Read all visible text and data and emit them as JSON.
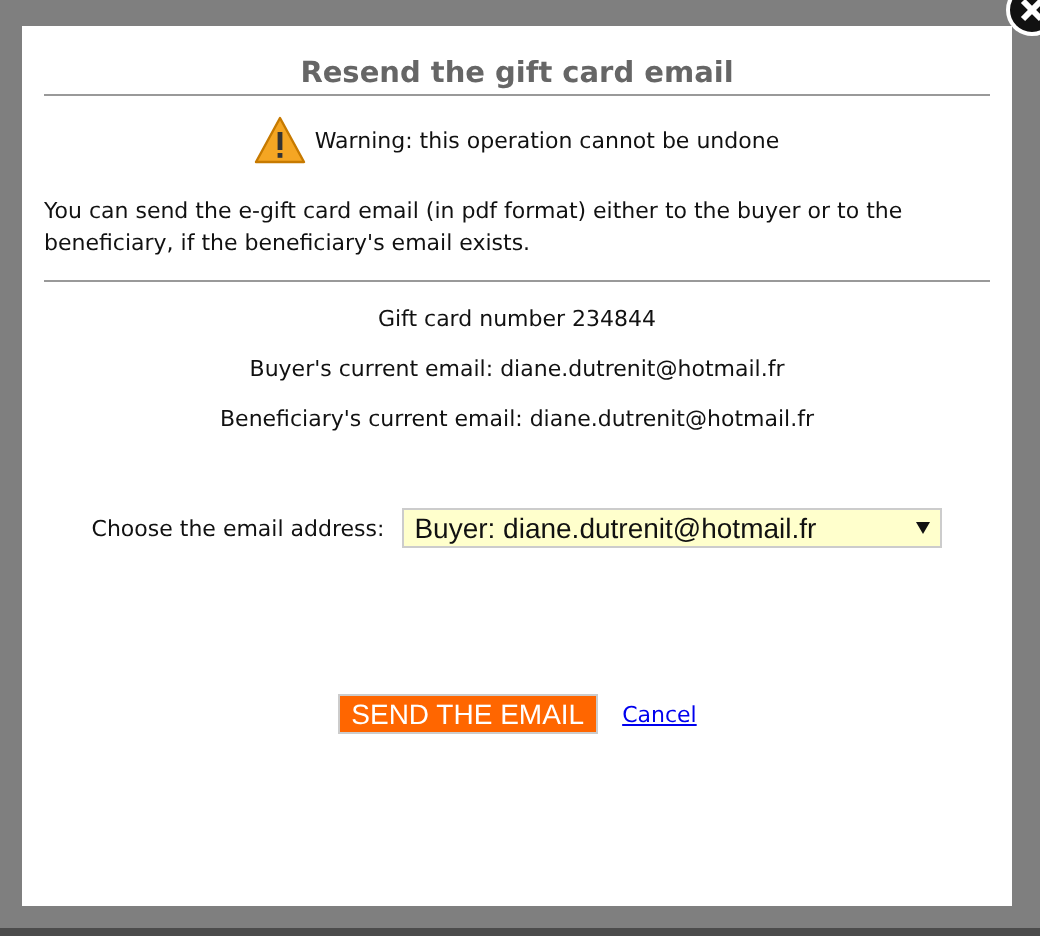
{
  "dialog": {
    "title": "Resend the gift card email",
    "warning": "Warning: this operation cannot be undone",
    "description": "You can send the e-gift card email (in pdf format) either to the buyer or to the beneficiary, if the beneficiary's email exists.",
    "details": [
      "Gift card number 234844",
      "Buyer's current email: diane.dutrenit@hotmail.fr",
      "Beneficiary's current email: diane.dutrenit@hotmail.fr"
    ],
    "email_select": {
      "label": "Choose the email address:",
      "value": "Buyer: diane.dutrenit@hotmail.fr"
    },
    "buttons": [
      {
        "kind": "primary",
        "label": "SEND THE EMAIL"
      },
      {
        "kind": "link",
        "label": "Cancel"
      }
    ]
  }
}
